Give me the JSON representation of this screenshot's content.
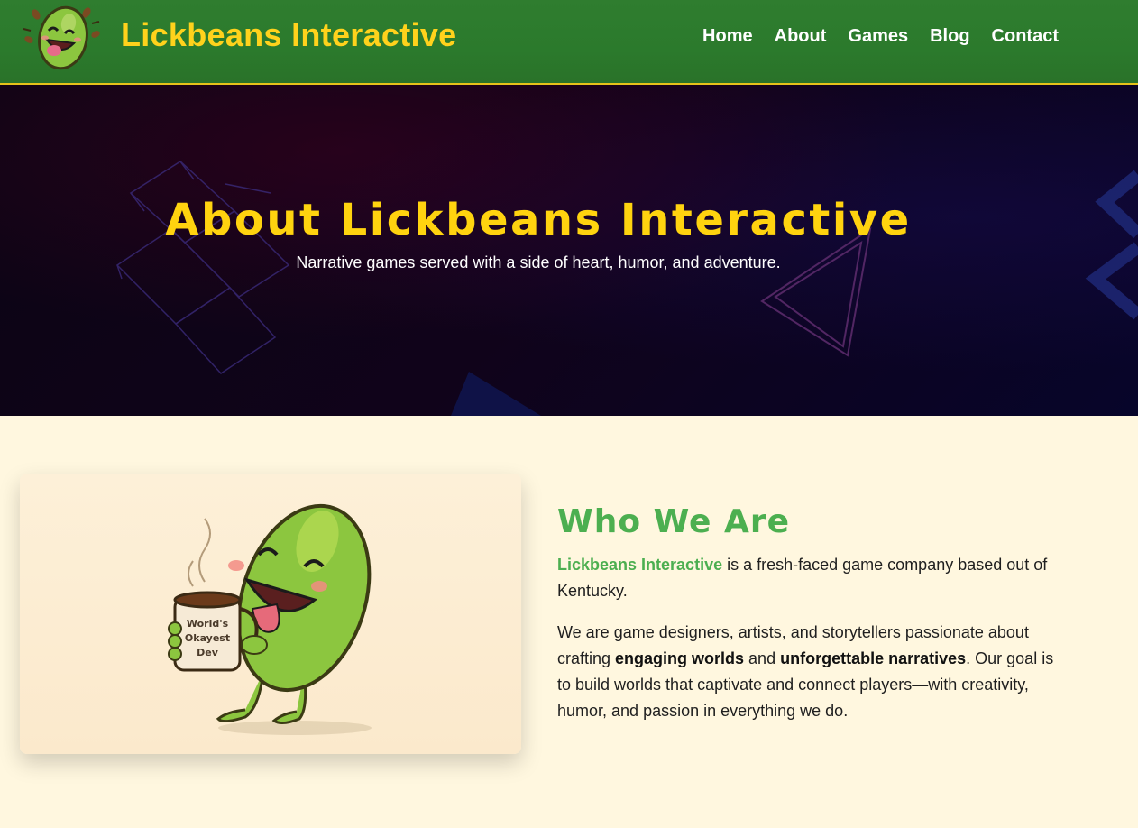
{
  "header": {
    "brand": "Lickbeans Interactive",
    "logo_icon": "laughing-bean-icon",
    "nav": [
      "Home",
      "About",
      "Games",
      "Blog",
      "Contact"
    ]
  },
  "hero": {
    "title": "About Lickbeans Interactive",
    "subtitle": "Narrative games served with a side of heart, humor, and adventure."
  },
  "about": {
    "title": "Who We Are",
    "illustration": "bean-mascot-with-mug-illustration",
    "mug_text": "World's Okayest Dev",
    "p1_highlight": "Lickbeans Interactive",
    "p1_rest": " is a fresh-faced game company based out of Kentucky.",
    "p2_a": "We are game designers, artists, and storytellers passionate about crafting ",
    "p2_b1": "engaging worlds",
    "p2_c": " and ",
    "p2_b2": "unforgettable narratives",
    "p2_d": ". Our goal is to build worlds that captivate and connect players—with creativity, humor, and passion in everything we do."
  },
  "colors": {
    "header_green": "#2b7a2c",
    "brand_yellow": "#ffd21c",
    "accent_green": "#4caf50",
    "page_bg": "#fff7df"
  }
}
